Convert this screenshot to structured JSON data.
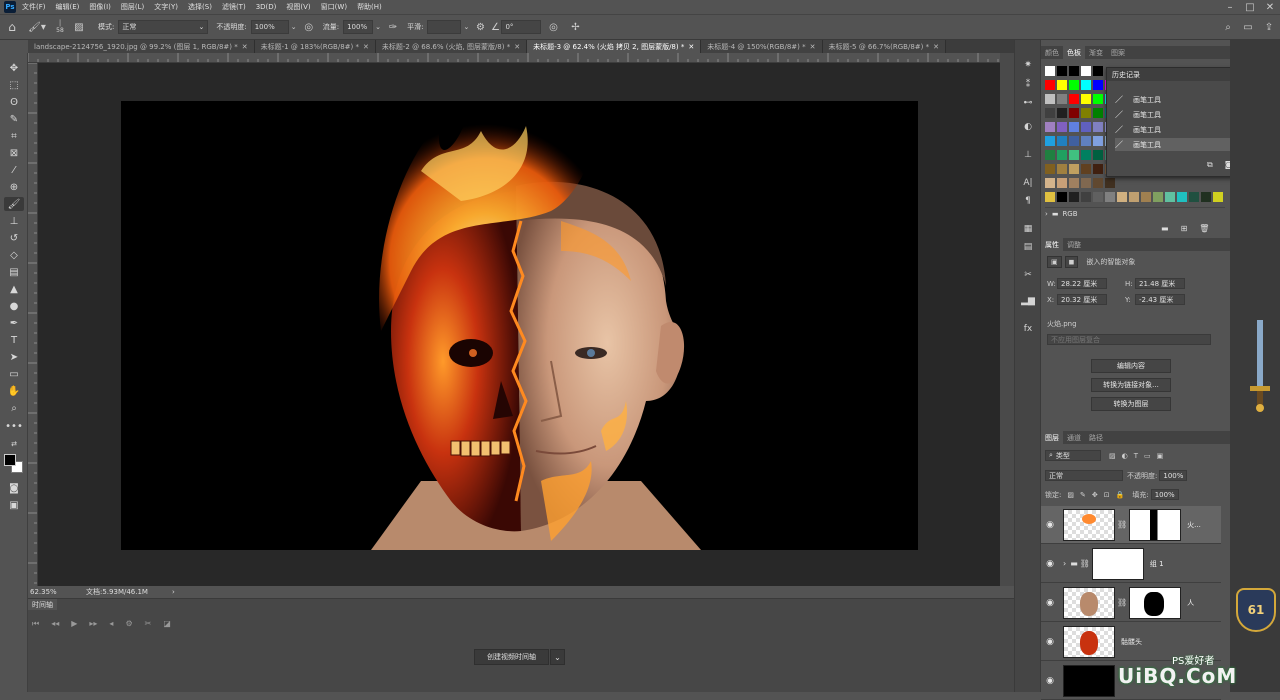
{
  "menu": {
    "logo": "Ps",
    "items": [
      "文件(F)",
      "编辑(E)",
      "图像(I)",
      "图层(L)",
      "文字(Y)",
      "选择(S)",
      "滤镜(T)",
      "3D(D)",
      "视图(V)",
      "窗口(W)",
      "帮助(H)"
    ]
  },
  "options": {
    "brush_size": "58",
    "mode_label": "模式:",
    "mode_value": "正常",
    "opacity_label": "不透明度:",
    "opacity_value": "100%",
    "flow_label": "流量:",
    "flow_value": "100%",
    "smooth_label": "平滑:",
    "angle_value": "0°"
  },
  "tabs": [
    {
      "label": "landscape-2124756_1920.jpg @ 99.2% (图层 1, RGB/8#) *"
    },
    {
      "label": "未标题-1 @ 183%(RGB/8#) *"
    },
    {
      "label": "未标题-2 @ 68.6% (火焰, 图层蒙版/8) *"
    },
    {
      "label": "未标题-3 @ 62.4% (火焰 拷贝 2, 图层蒙版/8) *"
    },
    {
      "label": "未标题-4 @ 150%(RGB/8#) *"
    },
    {
      "label": "未标题-5 @ 66.7%(RGB/8#) *"
    }
  ],
  "status": {
    "zoom": "62.35%",
    "doc_info": "文档:5.93M/46.1M"
  },
  "timeline": {
    "tab": "时间轴",
    "create_button": "创建视频时间轴"
  },
  "swatches_tabs": [
    "颜色",
    "色板",
    "渐变",
    "图案"
  ],
  "swatch_group": "RGB",
  "history": {
    "title": "历史记录",
    "items": [
      "画笔工具",
      "画笔工具",
      "画笔工具",
      "画笔工具"
    ]
  },
  "properties": {
    "tabs": [
      "属性",
      "调整"
    ],
    "object_type": "嵌入的智能对象",
    "w_label": "W:",
    "w_value": "28.22 厘米",
    "h_label": "H:",
    "h_value": "21.48 厘米",
    "x_label": "X:",
    "x_value": "20.32 厘米",
    "y_label": "Y:",
    "y_value": "-2.43 厘米",
    "file": "火焰.png",
    "comp_placeholder": "不应用图层复合",
    "btn_edit": "编辑内容",
    "btn_convert_linked": "转换为链接对象...",
    "btn_convert_layers": "转换为图层"
  },
  "layers": {
    "tabs": [
      "图层",
      "通道",
      "路径"
    ],
    "filter_kind": "类型",
    "blend_mode": "正常",
    "opacity_label": "不透明度:",
    "opacity_value": "100%",
    "lock_label": "锁定:",
    "fill_label": "填充:",
    "fill_value": "100%",
    "items": [
      {
        "name": "火..."
      },
      {
        "name": "组 1"
      },
      {
        "name": "人"
      },
      {
        "name": "骷髅头"
      },
      {
        "name": ""
      }
    ]
  },
  "badge": "61",
  "watermark": "UiBQ.CoM",
  "watermark_small": "PS爱好者",
  "colors": {
    "ui_bg": "#535353",
    "canvas_bg": "#282828",
    "accent": "#31a8ff",
    "fire": "#ff7a10"
  }
}
